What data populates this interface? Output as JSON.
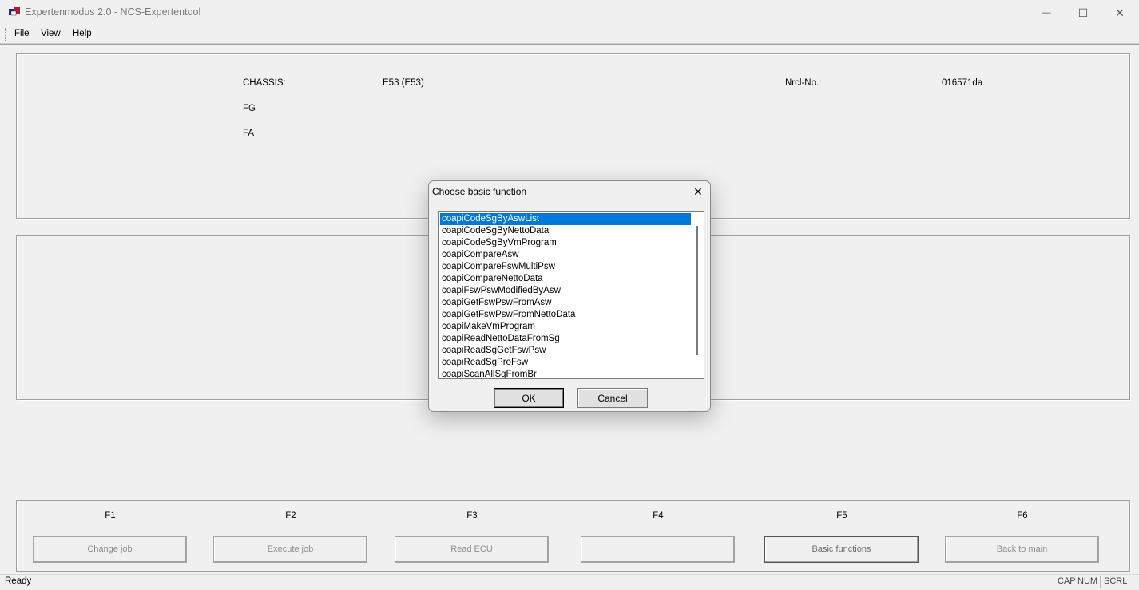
{
  "window": {
    "title": "Expertenmodus 2.0 - NCS-Expertentool",
    "minimize_glyph": "—",
    "maximize_glyph": "☐",
    "close_glyph": "✕"
  },
  "menu": {
    "items": [
      "File",
      "View",
      "Help"
    ]
  },
  "info": {
    "chassis_label": "CHASSIS:",
    "chassis_value": "E53 (E53)",
    "nrcl_label": "Nrcl-No.:",
    "nrcl_value": "016571da",
    "fg_label": "FG",
    "fa_label": "FA"
  },
  "function_keys": [
    {
      "key": "F1",
      "label": "Change job"
    },
    {
      "key": "F2",
      "label": "Execute job"
    },
    {
      "key": "F3",
      "label": "Read ECU"
    },
    {
      "key": "F4",
      "label": ""
    },
    {
      "key": "F5",
      "label": "Basic functions"
    },
    {
      "key": "F6",
      "label": "Back to main"
    }
  ],
  "status": {
    "text": "Ready",
    "indicators": [
      "CAP",
      "NUM",
      "SCRL"
    ]
  },
  "dialog": {
    "title": "Choose basic function",
    "close_glyph": "✕",
    "items": [
      "coapiCodeSgByAswList",
      "coapiCodeSgByNettoData",
      "coapiCodeSgByVmProgram",
      "coapiCompareAsw",
      "coapiCompareFswMultiPsw",
      "coapiCompareNettoData",
      "coapiFswPswModifiedByAsw",
      "coapiGetFswPswFromAsw",
      "coapiGetFswPswFromNettoData",
      "coapiMakeVmProgram",
      "coapiReadNettoDataFromSg",
      "coapiReadSgGetFswPsw",
      "coapiReadSgProFsw",
      "coapiScanAllSgFromBr"
    ],
    "selected_index": 0,
    "ok_label": "OK",
    "cancel_label": "Cancel"
  }
}
